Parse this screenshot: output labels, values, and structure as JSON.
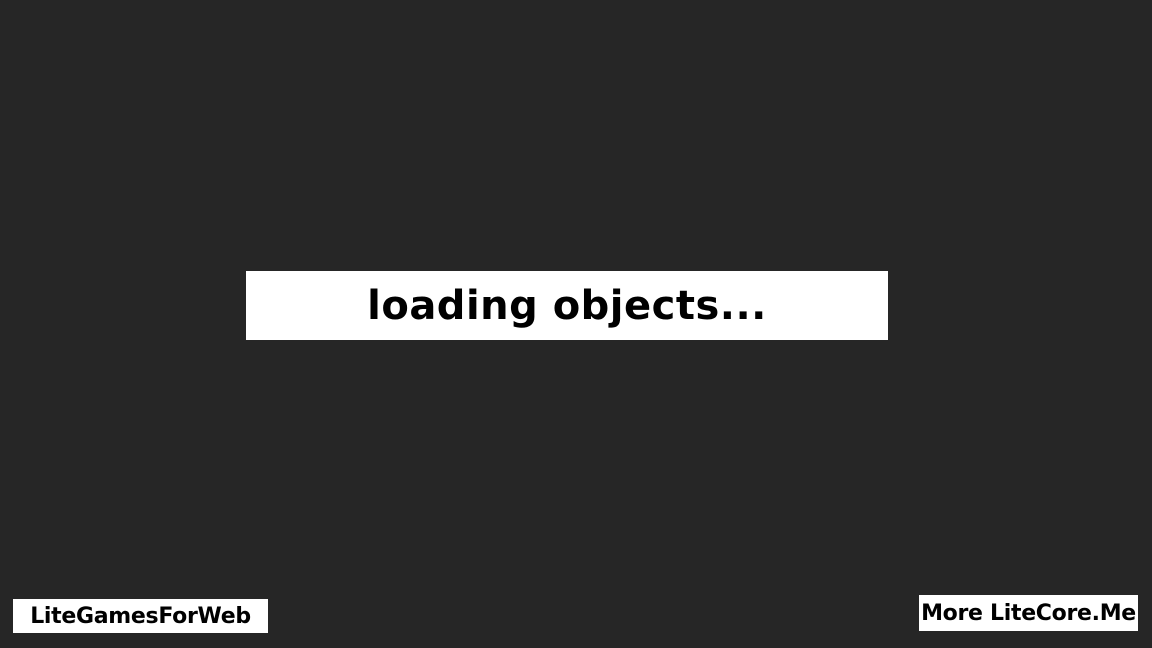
{
  "game": {
    "loading_text": "loading objects...",
    "colors": {
      "background": "#262626",
      "panel": "#ffffff",
      "text": "#000000"
    }
  },
  "footer": {
    "left_link_label": "LiteGamesForWeb",
    "right_link_label": "More LiteCore.Me"
  }
}
